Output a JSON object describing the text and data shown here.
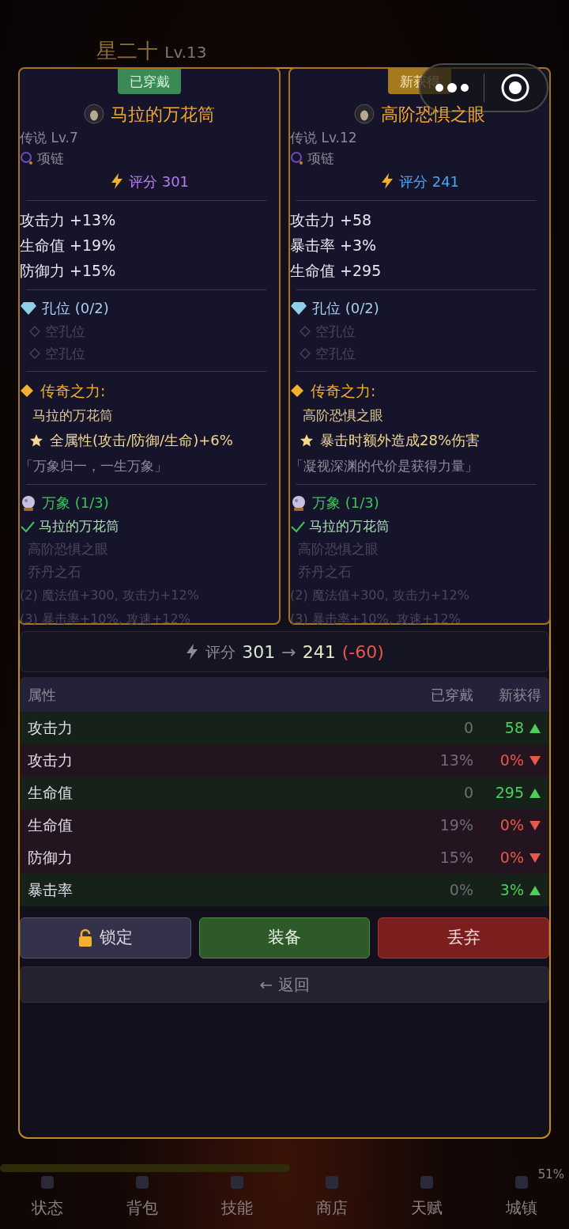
{
  "background": {
    "title": "星二十",
    "level": "Lv.13",
    "xp_text": "51%",
    "nav": [
      {
        "label": "状态"
      },
      {
        "label": "背包"
      },
      {
        "label": "技能"
      },
      {
        "label": "商店"
      },
      {
        "label": "天赋"
      },
      {
        "label": "城镇"
      }
    ]
  },
  "cards": [
    {
      "badge": "已穿戴",
      "kind": "equipped",
      "name": "马拉的万花筒",
      "rarity": "传说",
      "level": "Lv.7",
      "slot": "项链",
      "score": "评分 301",
      "color": "#b77cf0",
      "stats": [
        "攻击力 +13%",
        "生命值 +19%",
        "防御力 +15%"
      ],
      "sockets_title": "孔位 (0/2)",
      "sockets": [
        "空孔位",
        "空孔位"
      ],
      "legend_title": "传奇之力:",
      "legend_name": "马拉的万花筒",
      "legend_effect": "全属性(攻击/防御/生命)+6%",
      "quote": "「万象归一，一生万象」",
      "set_title": "万象 (1/3)",
      "set_pieces": [
        {
          "name": "马拉的万花筒",
          "owned": true
        },
        {
          "name": "高阶恐惧之眼",
          "owned": false
        },
        {
          "name": "乔丹之石",
          "owned": false
        }
      ],
      "set_bonuses": [
        "(2) 魔法值+300, 攻击力+12%",
        "(3) 暴击率+10%, 攻速+12%"
      ]
    },
    {
      "badge": "新获得",
      "kind": "new",
      "name": "高阶恐惧之眼",
      "rarity": "传说",
      "level": "Lv.12",
      "slot": "项链",
      "score": "评分 241",
      "color": "#4fa3f0",
      "stats": [
        "攻击力 +58",
        "暴击率 +3%",
        "生命值 +295"
      ],
      "sockets_title": "孔位 (0/2)",
      "sockets": [
        "空孔位",
        "空孔位"
      ],
      "legend_title": "传奇之力:",
      "legend_name": "高阶恐惧之眼",
      "legend_effect": "暴击时额外造成28%伤害",
      "quote": "「凝视深渊的代价是获得力量」",
      "set_title": "万象 (1/3)",
      "set_pieces": [
        {
          "name": "马拉的万花筒",
          "owned": true
        },
        {
          "name": "高阶恐惧之眼",
          "owned": false
        },
        {
          "name": "乔丹之石",
          "owned": false
        }
      ],
      "set_bonuses": [
        "(2) 魔法值+300, 攻击力+12%",
        "(3) 暴击率+10%, 攻速+12%"
      ]
    }
  ],
  "comparison": {
    "label": "评分",
    "old": "301",
    "arrow": "→",
    "new": "241",
    "diff": "(-60)"
  },
  "table": {
    "columns": [
      "属性",
      "已穿戴",
      "新获得"
    ],
    "rows": [
      {
        "name": "攻击力",
        "old": "0",
        "new": "58",
        "kind": "up"
      },
      {
        "name": "攻击力",
        "old": "13%",
        "new": "0%",
        "kind": "down"
      },
      {
        "name": "生命值",
        "old": "0",
        "new": "295",
        "kind": "up"
      },
      {
        "name": "生命值",
        "old": "19%",
        "new": "0%",
        "kind": "down"
      },
      {
        "name": "防御力",
        "old": "15%",
        "new": "0%",
        "kind": "down"
      },
      {
        "name": "暴击率",
        "old": "0%",
        "new": "3%",
        "kind": "up"
      }
    ]
  },
  "buttons": [
    {
      "label": "锁定",
      "kind": "lock"
    },
    {
      "label": "装备",
      "kind": "equip"
    },
    {
      "label": "丢弃",
      "kind": "discard"
    }
  ],
  "back": {
    "label": "← 返回"
  }
}
